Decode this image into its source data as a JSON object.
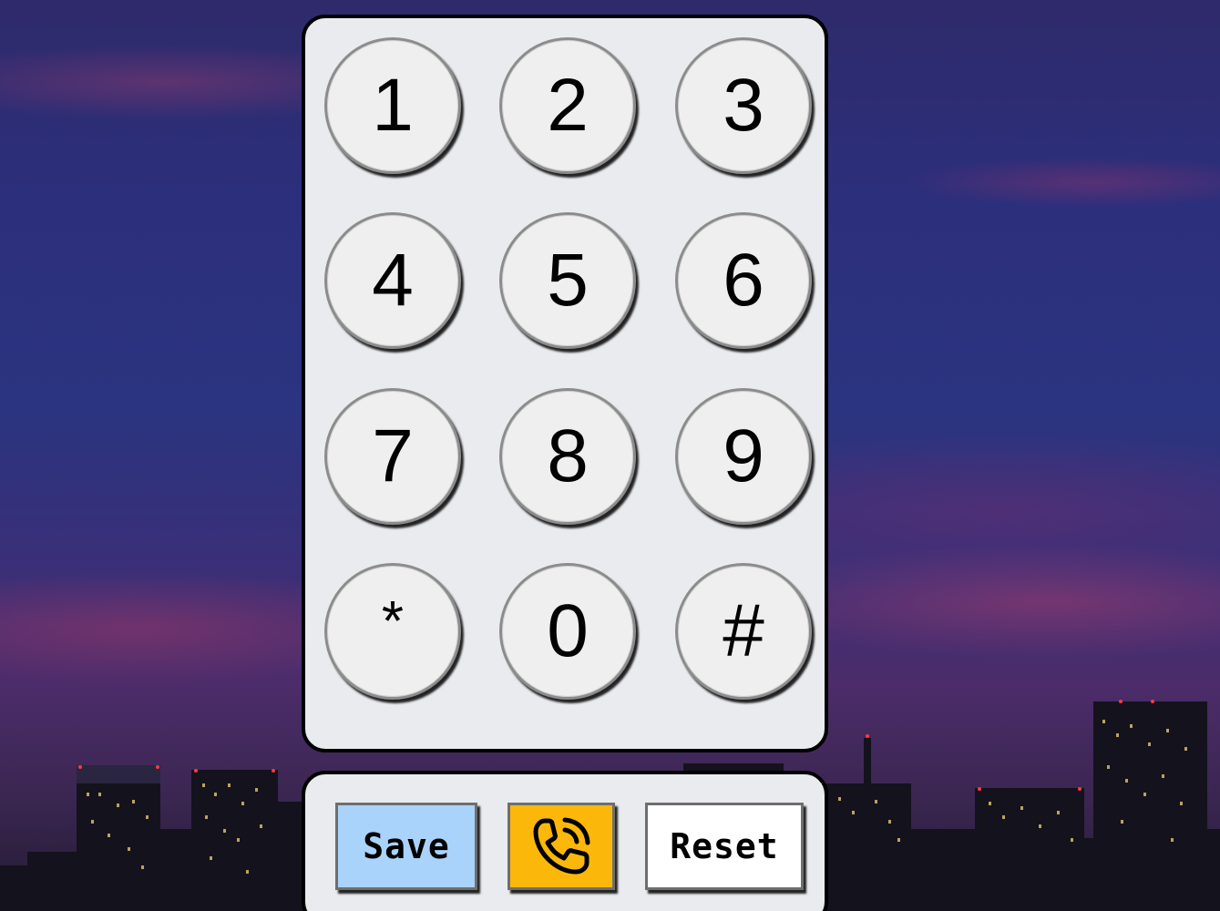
{
  "keypad": {
    "keys": [
      {
        "label": "1",
        "name": "key-1"
      },
      {
        "label": "2",
        "name": "key-2"
      },
      {
        "label": "3",
        "name": "key-3"
      },
      {
        "label": "4",
        "name": "key-4"
      },
      {
        "label": "5",
        "name": "key-5"
      },
      {
        "label": "6",
        "name": "key-6"
      },
      {
        "label": "7",
        "name": "key-7"
      },
      {
        "label": "8",
        "name": "key-8"
      },
      {
        "label": "9",
        "name": "key-9"
      },
      {
        "label": "*",
        "name": "key-star"
      },
      {
        "label": "0",
        "name": "key-0"
      },
      {
        "label": "#",
        "name": "key-hash"
      }
    ]
  },
  "actions": {
    "save_label": "Save",
    "call_icon": "phone-call-icon",
    "reset_label": "Reset"
  },
  "colors": {
    "save_button": "#a9d3fb",
    "call_button": "#fbb80a",
    "reset_button": "#ffffff",
    "panel": "#e9ebef",
    "key": "#efefef"
  }
}
